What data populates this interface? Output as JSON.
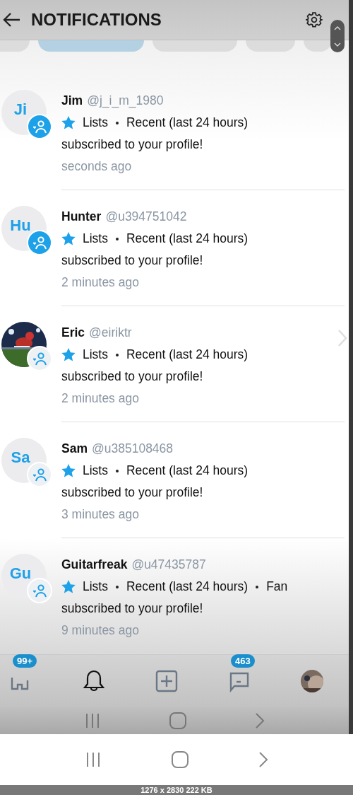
{
  "header": {
    "title": "NOTIFICATIONS"
  },
  "tabs": [
    {
      "selected": false
    },
    {
      "selected": true
    },
    {
      "selected": false
    },
    {
      "selected": false
    },
    {
      "selected": false
    }
  ],
  "notifications": [
    {
      "initials": "Ji",
      "kind": "initials",
      "new": true,
      "name": "Jim",
      "handle": "@j_i_m_1980",
      "lists": [
        "Lists",
        "Recent (last 24 hours)"
      ],
      "message": "subscribed to your profile!",
      "time": "seconds ago"
    },
    {
      "initials": "Hu",
      "kind": "initials",
      "new": true,
      "name": "Hunter",
      "handle": "@u394751042",
      "lists": [
        "Lists",
        "Recent (last 24 hours)"
      ],
      "message": "subscribed to your profile!",
      "time": "2 minutes ago"
    },
    {
      "kind": "picture",
      "new": false,
      "name": "Eric",
      "handle": "@eiriktr",
      "lists": [
        "Lists",
        "Recent (last 24 hours)"
      ],
      "message": "subscribed to your profile!",
      "time": "2 minutes ago"
    },
    {
      "initials": "Sa",
      "kind": "initials",
      "new": false,
      "name": "Sam",
      "handle": "@u385108468",
      "lists": [
        "Lists",
        "Recent (last 24 hours)"
      ],
      "message": "subscribed to your profile!",
      "time": "3 minutes ago"
    },
    {
      "initials": "Gu",
      "kind": "initials",
      "new": false,
      "name": "Guitarfreak",
      "handle": "@u47435787",
      "lists": [
        "Lists",
        "Recent (last 24 hours)",
        "Fan"
      ],
      "message": "subscribed to your profile!",
      "time": "9 minutes ago"
    }
  ],
  "bottom_nav": [
    {
      "kind": "home",
      "selected": false,
      "badge": "99+"
    },
    {
      "kind": "bell",
      "selected": true
    },
    {
      "kind": "add",
      "selected": false
    },
    {
      "kind": "chat",
      "selected": false,
      "badge": "463"
    },
    {
      "kind": "avatar",
      "selected": false
    }
  ],
  "image_info": "1276 x 2830 222 KB"
}
